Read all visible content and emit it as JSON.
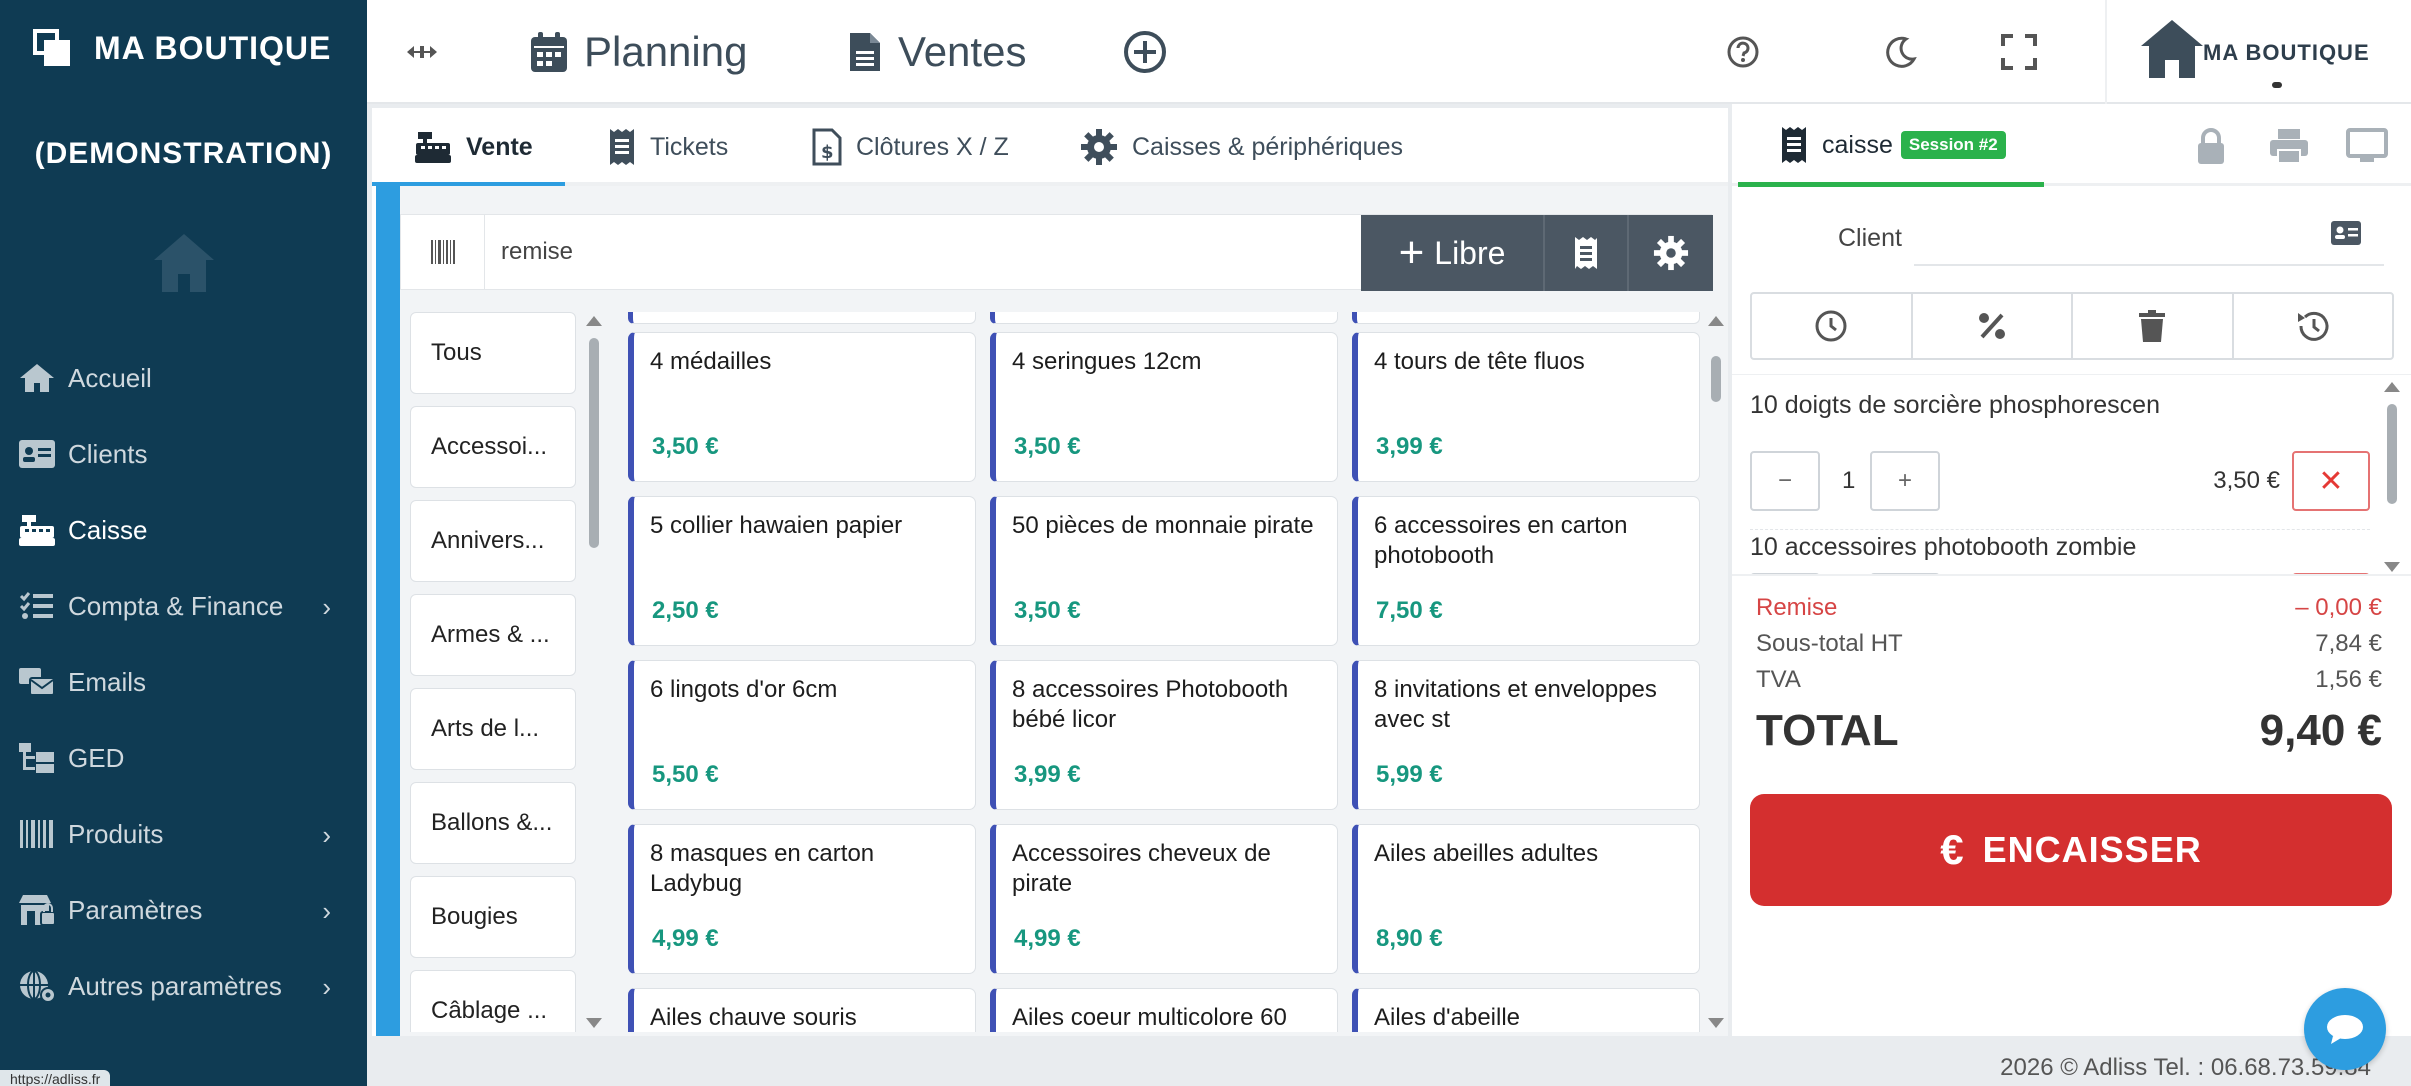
{
  "sidebar": {
    "brand_name": "MA BOUTIQUE",
    "brand_sub": "(DEMONSTRATION)",
    "items": [
      {
        "label": "Accueil",
        "icon": "home-icon",
        "chevron": false,
        "active": false
      },
      {
        "label": "Clients",
        "icon": "id-card-icon",
        "chevron": false,
        "active": false
      },
      {
        "label": "Caisse",
        "icon": "cash-register-icon",
        "chevron": false,
        "active": true
      },
      {
        "label": "Compta & Finance",
        "icon": "list-check-icon",
        "chevron": true,
        "active": false
      },
      {
        "label": "Emails",
        "icon": "mail-bulk-icon",
        "chevron": false,
        "active": false
      },
      {
        "label": "GED",
        "icon": "folder-tree-icon",
        "chevron": false,
        "active": false
      },
      {
        "label": "Produits",
        "icon": "barcode-icon",
        "chevron": true,
        "active": false
      },
      {
        "label": "Paramètres",
        "icon": "store-lock-icon",
        "chevron": true,
        "active": false
      },
      {
        "label": "Autres paramètres",
        "icon": "globe-gear-icon",
        "chevron": true,
        "active": false
      }
    ],
    "status_url": "https://adliss.fr"
  },
  "topbar": {
    "planning_label": "Planning",
    "ventes_label": "Ventes",
    "shop_name": "MA BOUTIQUE"
  },
  "subtabs": {
    "vente": "Vente",
    "tickets": "Tickets",
    "clotures": "Clôtures X / Z",
    "caisses": "Caisses & périphériques"
  },
  "search": {
    "value": "remise",
    "libre_label": "Libre"
  },
  "categories": [
    "Tous",
    "Accessoi...",
    "Annivers...",
    "Armes & ...",
    "Arts de l...",
    "Ballons &...",
    "Bougies",
    "Câblage ..."
  ],
  "products": [
    {
      "name": "4 médailles",
      "price": "3,50 €"
    },
    {
      "name": "4 seringues 12cm",
      "price": "3,50 €"
    },
    {
      "name": "4 tours de tête fluos",
      "price": "3,99 €"
    },
    {
      "name": "5 collier hawaien papier",
      "price": "2,50 €"
    },
    {
      "name": "50 pièces de monnaie pirate",
      "price": "3,50 €"
    },
    {
      "name": "6 accessoires en carton photobooth",
      "price": "7,50 €"
    },
    {
      "name": "6 lingots d'or 6cm",
      "price": "5,50 €"
    },
    {
      "name": "8 accessoires Photobooth bébé licor",
      "price": "3,99 €"
    },
    {
      "name": "8 invitations et enveloppes avec st",
      "price": "5,99 €"
    },
    {
      "name": "8 masques en carton Ladybug",
      "price": "4,99 €"
    },
    {
      "name": "Accessoires cheveux de pirate",
      "price": "4,99 €"
    },
    {
      "name": "Ailes abeilles adultes",
      "price": "8,90 €"
    },
    {
      "name": "Ailes chauve souris",
      "price": ""
    },
    {
      "name": "Ailes coeur multicolore 60",
      "price": ""
    },
    {
      "name": "Ailes d'abeille",
      "price": ""
    }
  ],
  "register": {
    "tab_label": "caisse",
    "session_badge": "Session #2",
    "client_label": "Client",
    "lines": [
      {
        "name": "10 doigts de sorcière phosphorescen",
        "qty": "1",
        "price": "3,50 €",
        "minus": "−",
        "plus": "+",
        "delete": "✕"
      },
      {
        "name": "10 accessoires photobooth zombie",
        "qty": "",
        "price": "",
        "minus": "",
        "plus": "",
        "delete": ""
      }
    ],
    "remise_label": "Remise",
    "remise_value": "– 0,00 €",
    "subtotal_label": "Sous-total HT",
    "subtotal_value": "7,84 €",
    "tva_label": "TVA",
    "tva_value": "1,56 €",
    "total_label": "TOTAL",
    "total_value": "9,40 €",
    "encaisser_label": "ENCAISSER",
    "encaisser_symbol": "€"
  },
  "footer": {
    "text": "2026 © Adliss Tel. : 06.68.73.59.84"
  },
  "colors": {
    "sidebar_bg": "#0f3b53",
    "accent_blue": "#2d9de0",
    "price_green": "#17977f",
    "product_border": "#3f51b5",
    "session_green": "#2bb24c",
    "encaisser_red": "#d42f2f"
  }
}
